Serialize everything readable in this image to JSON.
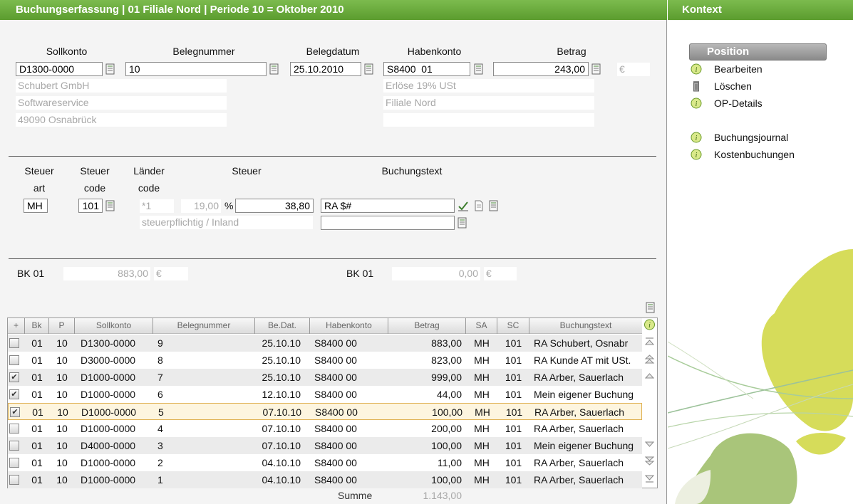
{
  "main_title": "Buchungserfassung | 01 Filiale Nord | Periode 10 = Oktober 2010",
  "context_title": "Kontext",
  "header_labels": {
    "sollkonto": "Sollkonto",
    "belegnummer": "Belegnummer",
    "belegdatum": "Belegdatum",
    "habenkonto": "Habenkonto",
    "betrag": "Betrag"
  },
  "fields": {
    "sollkonto": "D1300-0000",
    "belegnummer": "10",
    "belegdatum": "25.10.2010",
    "habenkonto": "S8400  01",
    "betrag": "243,00",
    "betrag_unit": "€"
  },
  "soll_info": [
    "Schubert GmbH",
    "Softwareservice",
    "49090 Osnabrück"
  ],
  "haben_info": [
    "Erlöse 19% USt",
    "Filiale Nord",
    ""
  ],
  "tax_labels": {
    "steuer_art_1": "Steuer",
    "steuer_art_2": "art",
    "steuer_code_1": "Steuer",
    "steuer_code_2": "code",
    "laender_1": "Länder",
    "laender_2": "code",
    "steuer": "Steuer",
    "buchungstext": "Buchungstext"
  },
  "tax": {
    "steuerart": "MH",
    "steuercode": "101",
    "laendercode": "*1",
    "satz": "19,00",
    "percent": "%",
    "steuerbetrag": "38,80",
    "steuer_desc": "steuerpflichtig / Inland",
    "buchungstext": "RA $#",
    "buchungstext2": ""
  },
  "balances": {
    "left_label": "BK 01",
    "left_value": "883,00",
    "left_unit": "€",
    "right_label": "BK 01",
    "right_value": "0,00",
    "right_unit": "€"
  },
  "table": {
    "columns": [
      "+",
      "Bk",
      "P",
      "Sollkonto",
      "Belegnummer",
      "Be.Dat.",
      "Habenkonto",
      "Betrag",
      "SA",
      "SC",
      "Buchungstext"
    ],
    "rows": [
      {
        "checked": "",
        "bk": "01",
        "p": "10",
        "soll": "D1300-0000",
        "beleg": "9",
        "datum": "25.10.10",
        "haben": "S8400  00",
        "betrag": "883,00",
        "sa": "MH",
        "sc": "101",
        "text": "RA Schubert,  Osnabr"
      },
      {
        "checked": "",
        "bk": "01",
        "p": "10",
        "soll": "D3000-0000",
        "beleg": "8",
        "datum": "25.10.10",
        "haben": "S8400  00",
        "betrag": "823,00",
        "sa": "MH",
        "sc": "101",
        "text": "RA Kunde AT mit USt."
      },
      {
        "checked": "✔",
        "bk": "01",
        "p": "10",
        "soll": "D1000-0000",
        "beleg": "7",
        "datum": "25.10.10",
        "haben": "S8400  00",
        "betrag": "999,00",
        "sa": "MH",
        "sc": "101",
        "text": "RA Arber,  Sauerlach"
      },
      {
        "checked": "✔",
        "bk": "01",
        "p": "10",
        "soll": "D1000-0000",
        "beleg": "6",
        "datum": "12.10.10",
        "haben": "S8400  00",
        "betrag": "44,00",
        "sa": "MH",
        "sc": "101",
        "text": "Mein eigener Buchung"
      },
      {
        "checked": "✔",
        "bk": "01",
        "p": "10",
        "soll": "D1000-0000",
        "beleg": "5",
        "datum": "07.10.10",
        "haben": "S8400  00",
        "betrag": "100,00",
        "sa": "MH",
        "sc": "101",
        "text": "RA Arber,  Sauerlach"
      },
      {
        "checked": "",
        "bk": "01",
        "p": "10",
        "soll": "D1000-0000",
        "beleg": "4",
        "datum": "07.10.10",
        "haben": "S8400  00",
        "betrag": "200,00",
        "sa": "MH",
        "sc": "101",
        "text": "RA Arber,  Sauerlach"
      },
      {
        "checked": "",
        "bk": "01",
        "p": "10",
        "soll": "D4000-0000",
        "beleg": "3",
        "datum": "07.10.10",
        "haben": "S8400  00",
        "betrag": "100,00",
        "sa": "MH",
        "sc": "101",
        "text": "Mein eigener Buchung"
      },
      {
        "checked": "",
        "bk": "01",
        "p": "10",
        "soll": "D1000-0000",
        "beleg": "2",
        "datum": "04.10.10",
        "haben": "S8400  00",
        "betrag": "11,00",
        "sa": "MH",
        "sc": "101",
        "text": "RA Arber,  Sauerlach"
      },
      {
        "checked": "",
        "bk": "01",
        "p": "10",
        "soll": "D1000-0000",
        "beleg": "1",
        "datum": "04.10.10",
        "haben": "S8400  00",
        "betrag": "100,00",
        "sa": "MH",
        "sc": "101",
        "text": "RA Arber,  Sauerlach"
      }
    ],
    "summe_label": "Summe",
    "summe_value": "1.143,00"
  },
  "context": {
    "section": "Position",
    "items": [
      "Bearbeiten",
      "Löschen",
      "OP-Details"
    ],
    "items2": [
      "Buchungsjournal",
      "Kostenbuchungen"
    ]
  },
  "colors": {
    "title_green": "#6aab3c",
    "selected_row": "#fdf5df",
    "deco_lime": "#d6dc5a",
    "deco_green": "#a9c57a"
  }
}
